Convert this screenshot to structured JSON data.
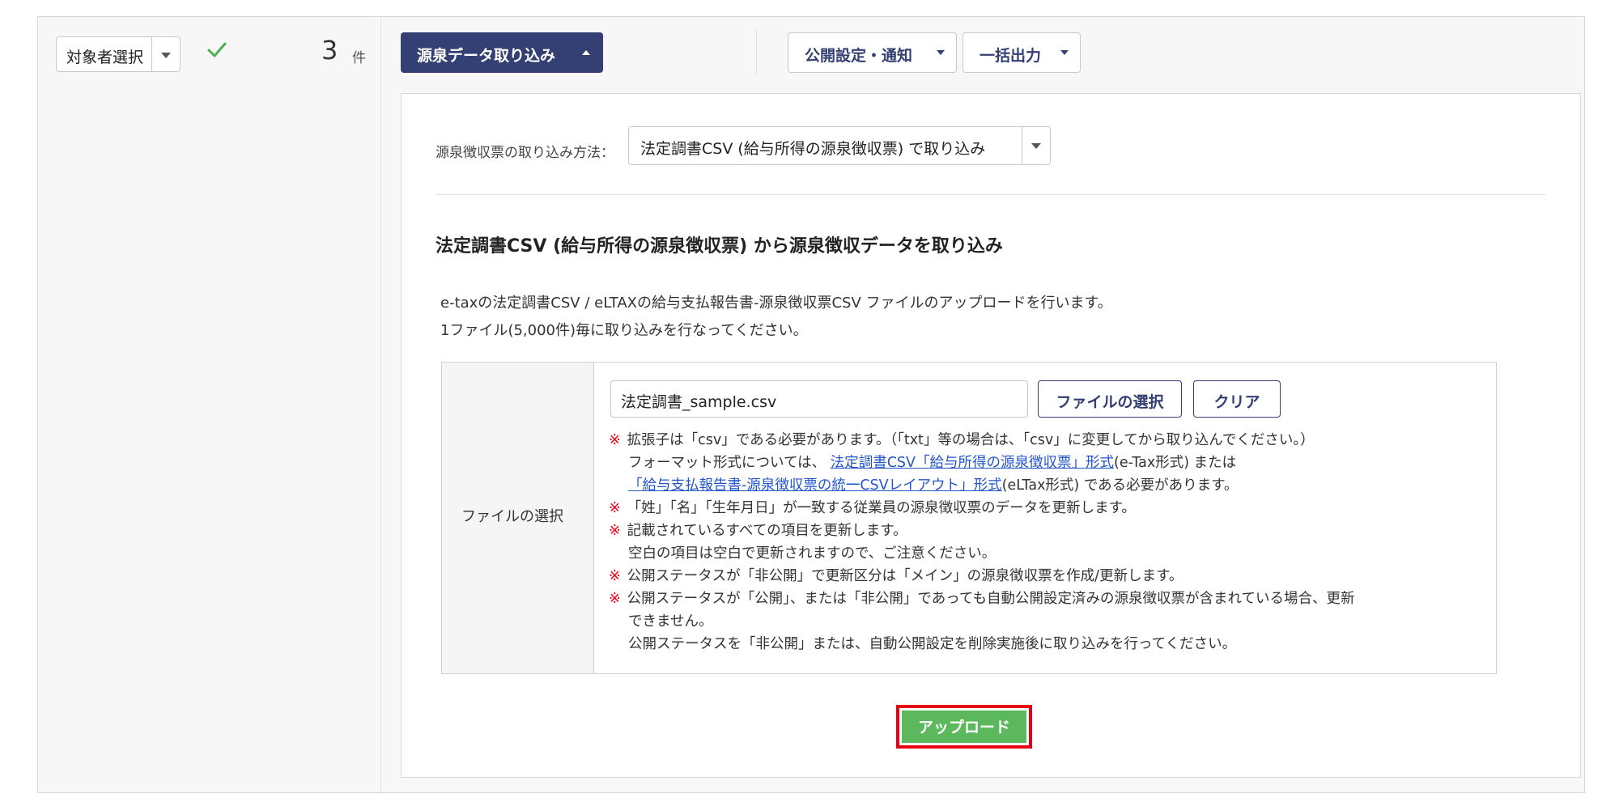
{
  "left": {
    "target_select": "対象者選択",
    "count": "3",
    "count_unit": "件"
  },
  "toolbar": {
    "import_button": "源泉データ取り込み",
    "publish_button": "公開設定・通知",
    "bulk_output_button": "一括出力"
  },
  "panel": {
    "method_label": "源泉徴収票の取り込み方法：",
    "method_selected": "法定調書CSV (給与所得の源泉徴収票) で取り込み",
    "section_title": "法定調書CSV (給与所得の源泉徴収票) から源泉徴収データを取り込み",
    "desc_line1": "e-taxの法定調書CSV / eLTAXの給与支払報告書-源泉徴収票CSV ファイルのアップロードを行います。",
    "desc_line2": "1ファイル(5,000件)毎に取り込みを行なってください。",
    "file_row_label": "ファイルの選択",
    "file_value": "法定調書_sample.csv",
    "choose_button": "ファイルの選択",
    "clear_button": "クリア",
    "note_mark": "※",
    "notes": {
      "n1": "拡張子は「csv」である必要があります。（「txt」等の場合は、「csv」に変更してから取り込んでください。）",
      "n1_format_prefix": "フォーマット形式については、",
      "n1_link1": "法定調書CSV「給与所得の源泉徴収票」形式",
      "n1_link1_suffix": "(e-Tax形式) または",
      "n1_link2": "「給与支払報告書-源泉徴収票の統一CSVレイアウト」形式",
      "n1_link2_suffix": "(eLTax形式) である必要があります。",
      "n2": "「姓」「名」「生年月日」が一致する従業員の源泉徴収票のデータを更新します。",
      "n3": "記載されているすべての項目を更新します。",
      "n3_sub": "空白の項目は空白で更新されますので、ご注意ください。",
      "n4": "公開ステータスが「非公開」で更新区分は「メイン」の源泉徴収票を作成/更新します。",
      "n5": "公開ステータスが「公開」、または「非公開」であっても自動公開設定済みの源泉徴収票が含まれている場合、更新",
      "n5_cont": "できません。",
      "n5_sub": "公開ステータスを「非公開」または、自動公開設定を削除実施後に取り込みを行ってください。"
    },
    "upload_button": "アップロード"
  },
  "colors": {
    "primary": "#343f73",
    "upload_green": "#5cb85c",
    "highlight_red": "#e60012",
    "check_green": "#4caf50",
    "link_blue": "#2255cc"
  },
  "icons": [
    "chevron-down-icon",
    "check-icon",
    "chevron-up-icon"
  ]
}
